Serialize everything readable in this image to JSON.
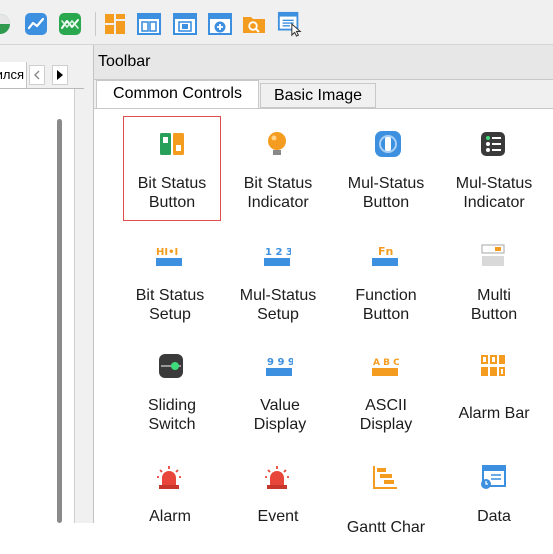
{
  "toolbar": {
    "buttons": [
      {
        "icon": "pie-chart-icon"
      },
      {
        "icon": "trend-chart-icon"
      },
      {
        "icon": "xy-chart-icon"
      },
      {
        "icon": "layout-icon"
      },
      {
        "icon": "window-icon"
      },
      {
        "icon": "screen-icon"
      },
      {
        "icon": "add-window-icon"
      },
      {
        "icon": "folder-search-icon"
      },
      {
        "icon": "properties-icon"
      }
    ]
  },
  "left_panel": {
    "tab_label": "ился",
    "prev_icon": "arrow-left-icon",
    "next_icon": "arrow-right-icon"
  },
  "panel": {
    "title": "Toolbar",
    "tabs": [
      {
        "label": "Common Controls",
        "active": true
      },
      {
        "label": "Basic Image",
        "active": false
      }
    ],
    "items": [
      {
        "label": "Bit Status\nButton",
        "icon": "bit-status-button-icon",
        "selected": true
      },
      {
        "label": "Bit Status\nIndicator",
        "icon": "bit-status-indicator-icon"
      },
      {
        "label": "Mul-Status\nButton",
        "icon": "mul-status-button-icon"
      },
      {
        "label": "Mul-Status\nIndicator",
        "icon": "mul-status-indicator-icon"
      },
      {
        "label": "Bit Status\nSetup",
        "icon": "bit-status-setup-icon"
      },
      {
        "label": "Mul-Status\nSetup",
        "icon": "mul-status-setup-icon"
      },
      {
        "label": "Function\nButton",
        "icon": "function-button-icon"
      },
      {
        "label": "Multi\nButton",
        "icon": "multi-button-icon"
      },
      {
        "label": "Sliding\nSwitch",
        "icon": "sliding-switch-icon"
      },
      {
        "label": "Value\nDisplay",
        "icon": "value-display-icon"
      },
      {
        "label": "ASCII\nDisplay",
        "icon": "ascii-display-icon"
      },
      {
        "label": "Alarm Bar",
        "icon": "alarm-bar-icon"
      },
      {
        "label": "Alarm",
        "icon": "alarm-icon"
      },
      {
        "label": "Event",
        "icon": "event-icon"
      },
      {
        "label": "Gantt Char",
        "icon": "gantt-chart-icon"
      },
      {
        "label": "Data",
        "icon": "data-icon"
      }
    ]
  },
  "colors": {
    "selection_border": "#e04b4b",
    "icon_blue": "#3d8fe0",
    "icon_orange": "#f39c1f",
    "icon_green": "#27a05a",
    "icon_red": "#e8463a"
  }
}
